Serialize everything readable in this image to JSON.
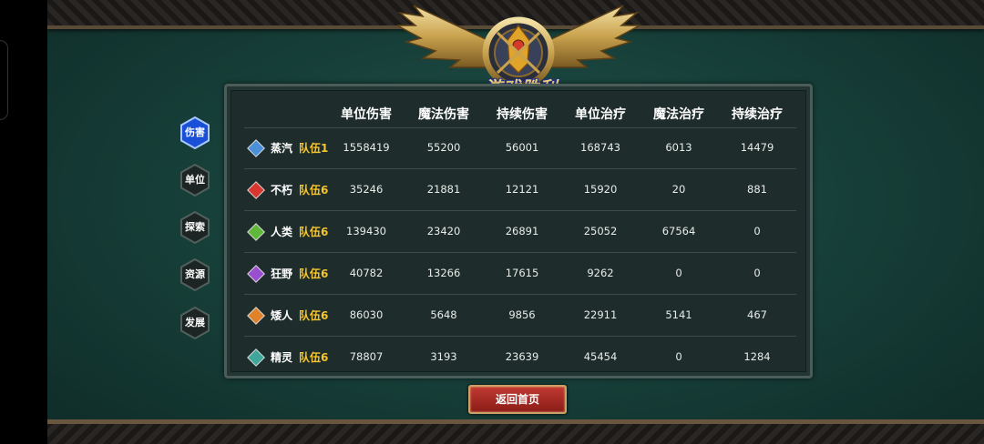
{
  "emblem": {
    "title": "游戏胜利"
  },
  "tabs": [
    {
      "label": "伤害",
      "active": true
    },
    {
      "label": "单位",
      "active": false
    },
    {
      "label": "探索",
      "active": false
    },
    {
      "label": "资源",
      "active": false
    },
    {
      "label": "发展",
      "active": false
    }
  ],
  "table": {
    "headers": [
      "单位伤害",
      "魔法伤害",
      "持续伤害",
      "单位治疗",
      "魔法治疗",
      "持续治疗"
    ],
    "rows": [
      {
        "race": "蒸汽",
        "team": "队伍1",
        "gem_color": "#4a90d9",
        "values": [
          "1558419",
          "55200",
          "56001",
          "168743",
          "6013",
          "14479"
        ]
      },
      {
        "race": "不朽",
        "team": "队伍6",
        "gem_color": "#d8362e",
        "values": [
          "35246",
          "21881",
          "12121",
          "15920",
          "20",
          "881"
        ]
      },
      {
        "race": "人类",
        "team": "队伍6",
        "gem_color": "#5fb83a",
        "values": [
          "139430",
          "23420",
          "26891",
          "25052",
          "67564",
          "0"
        ]
      },
      {
        "race": "狂野",
        "team": "队伍6",
        "gem_color": "#9a4fd0",
        "values": [
          "40782",
          "13266",
          "17615",
          "9262",
          "0",
          "0"
        ]
      },
      {
        "race": "矮人",
        "team": "队伍6",
        "gem_color": "#e0822a",
        "values": [
          "86030",
          "5648",
          "9856",
          "22911",
          "5141",
          "467"
        ]
      },
      {
        "race": "精灵",
        "team": "队伍6",
        "gem_color": "#3fa79a",
        "values": [
          "78807",
          "3193",
          "23639",
          "45454",
          "0",
          "1284"
        ]
      }
    ]
  },
  "return_button": {
    "label": "返回首页"
  }
}
